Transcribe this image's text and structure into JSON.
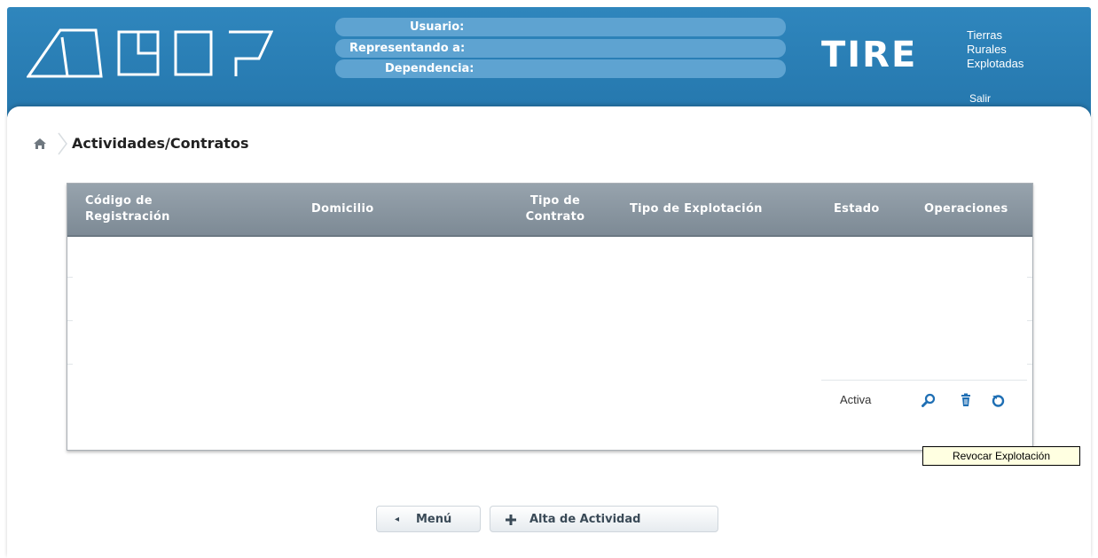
{
  "header": {
    "logo": "AFIP",
    "user_panel": {
      "usuario_label": "Usuario:",
      "representando_label": "Representando a:",
      "dependencia_label": "Dependencia:"
    },
    "app_acronym": "TIRE",
    "app_name_lines": [
      "Tierras",
      "Rurales",
      "Explotadas"
    ],
    "salir_label": "Salir"
  },
  "breadcrumb": {
    "home_icon": "home-icon",
    "title": "Actividades/Contratos"
  },
  "table": {
    "columns": [
      "Código de Registración",
      "Domicilio",
      "Tipo de Contrato",
      "Tipo de Explotación",
      "Estado",
      "Operaciones"
    ],
    "rows": [
      {
        "codigo": "",
        "domicilio": "",
        "tipo_contrato": "",
        "tipo_explotacion": "",
        "estado": "Activa",
        "operaciones": [
          "view-icon",
          "delete-icon",
          "revoke-icon"
        ]
      }
    ]
  },
  "tooltip": "Revocar Explotación",
  "buttons": {
    "menu": "Menú",
    "alta": "Alta de Actividad"
  },
  "colors": {
    "header_blue": "#2a7db5",
    "user_field": "#5ea3d1",
    "table_header": "#8995a0",
    "icon_blue": "#1f6fb4"
  }
}
